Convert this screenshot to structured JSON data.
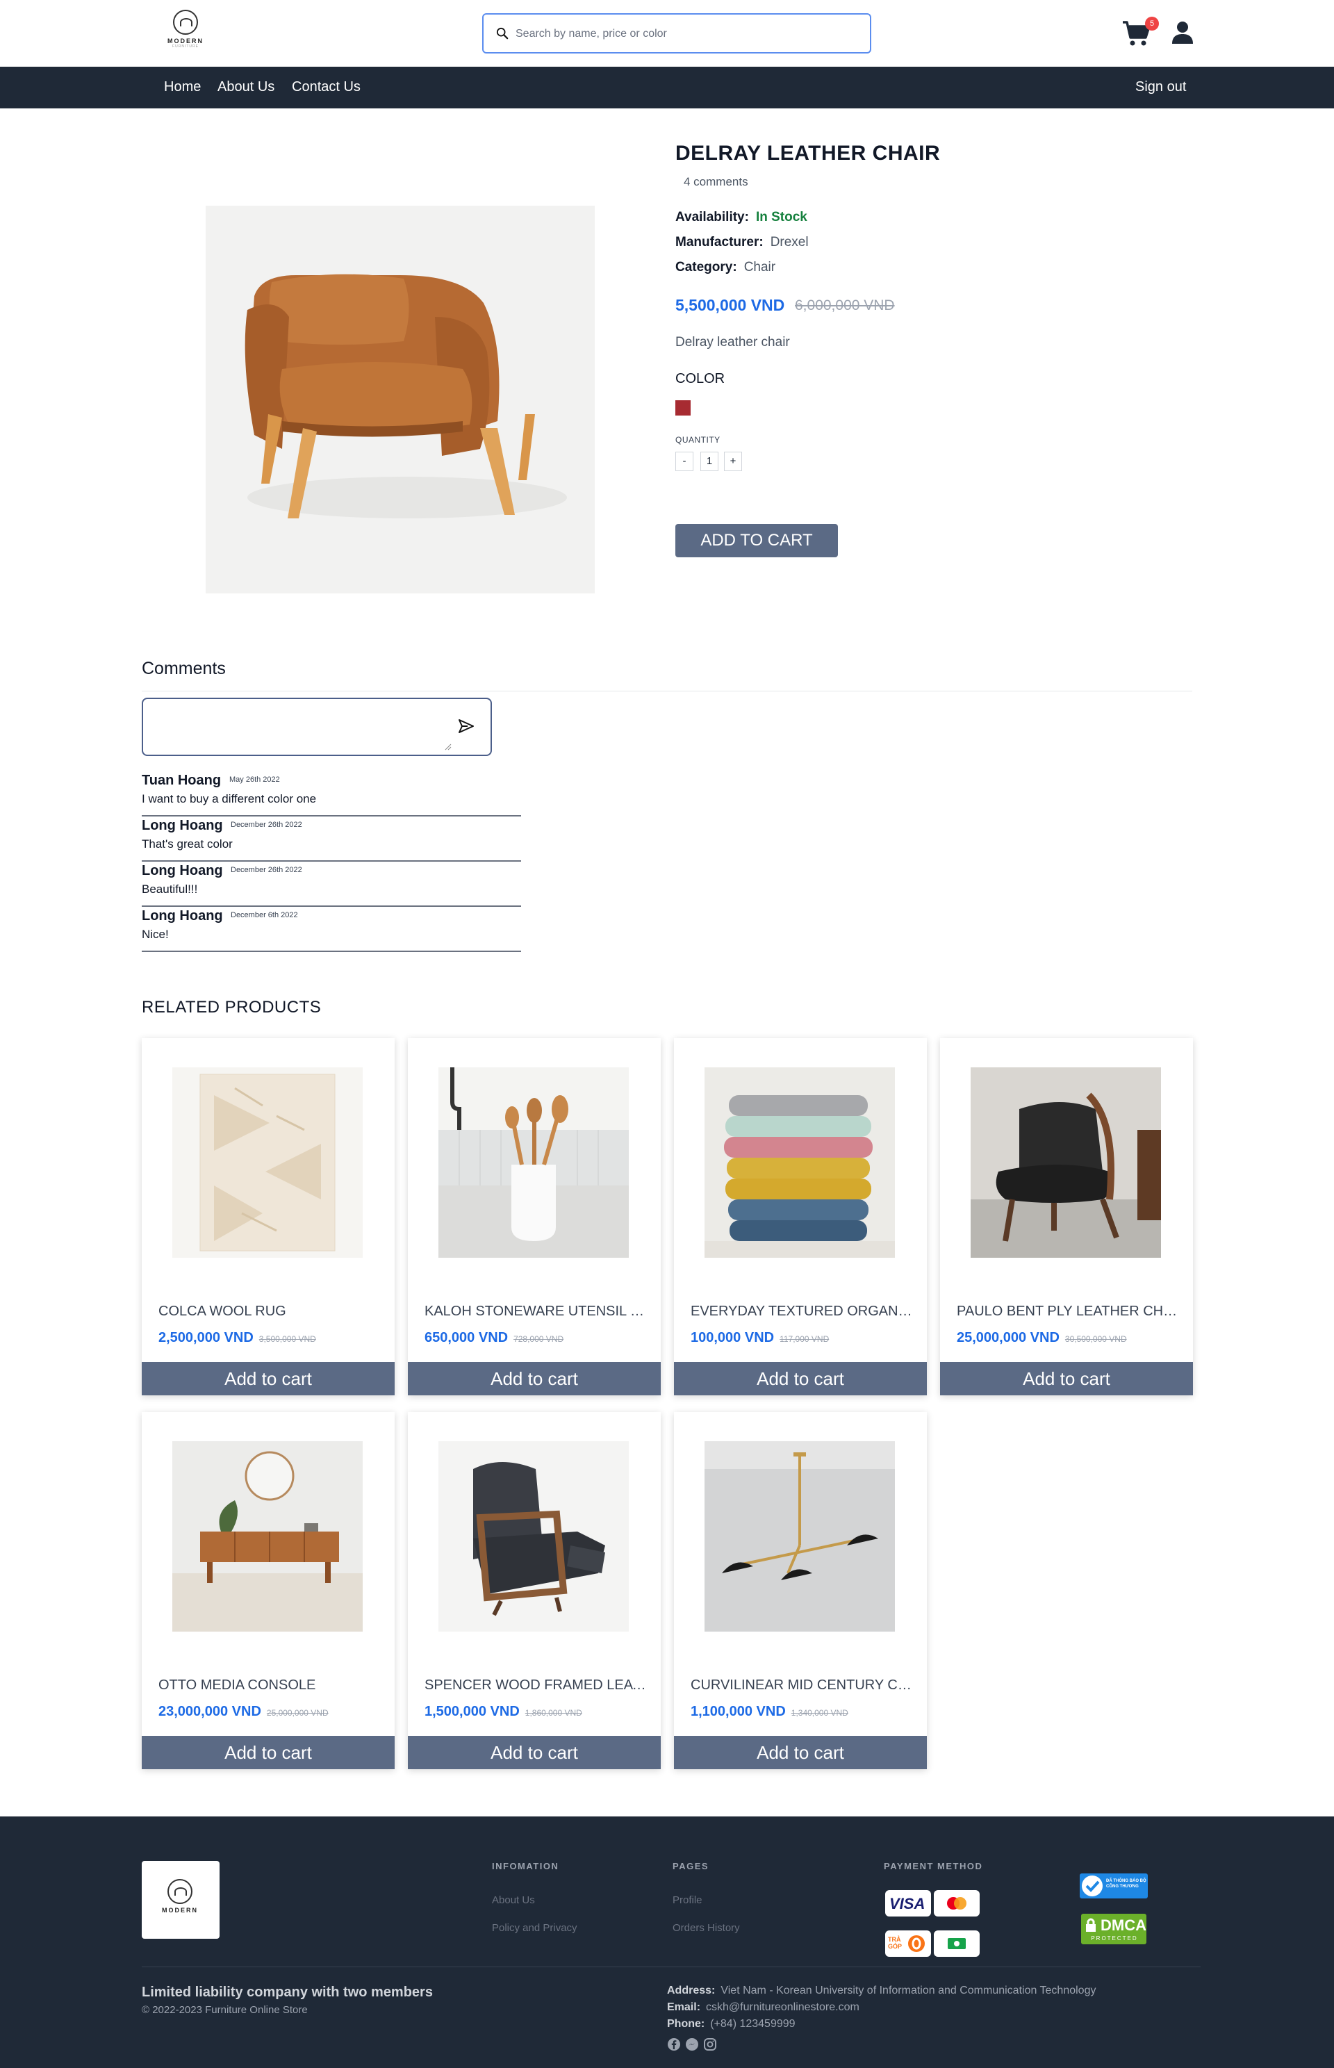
{
  "header": {
    "logo_text": "MODERN",
    "logo_sub": "FURNITURE",
    "search_placeholder": "Search by name, price or color",
    "cart_count": "5"
  },
  "nav": {
    "links": [
      "Home",
      "About Us",
      "Contact Us"
    ],
    "sign_out": "Sign out"
  },
  "product": {
    "title": "DELRAY LEATHER CHAIR",
    "comments_count": "4 comments",
    "availability_label": "Availability:",
    "availability_value": "In Stock",
    "manufacturer_label": "Manufacturer:",
    "manufacturer_value": "Drexel",
    "category_label": "Category:",
    "category_value": "Chair",
    "price": "5,500,000 VND",
    "old_price": "6,000,000 VND",
    "description": "Delray leather chair",
    "color_label": "COLOR",
    "color_swatch": "#a72b31",
    "quantity_label": "QUANTITY",
    "qty_minus": "-",
    "qty_value": "1",
    "qty_plus": "+",
    "add_to_cart": "ADD TO CART"
  },
  "comments": {
    "heading": "Comments",
    "items": [
      {
        "author": "Tuan Hoang",
        "date": "May 26th 2022",
        "text": "I want to buy a different color one"
      },
      {
        "author": "Long Hoang",
        "date": "December 26th 2022",
        "text": "That's great color"
      },
      {
        "author": "Long Hoang",
        "date": "December 26th 2022",
        "text": "Beautiful!!!"
      },
      {
        "author": "Long Hoang",
        "date": "December 6th 2022",
        "text": "Nice!"
      }
    ]
  },
  "related": {
    "heading": "RELATED PRODUCTS",
    "button_label": "Add to cart",
    "items": [
      {
        "name": "COLCA WOOL RUG",
        "price": "2,500,000 VND",
        "old_price": "3,500,000 VND"
      },
      {
        "name": "KALOH STONEWARE UTENSIL HOLDER",
        "price": "650,000 VND",
        "old_price": "728,000 VND"
      },
      {
        "name": "EVERYDAY TEXTURED ORGANIC COTTON TOWELS",
        "price": "100,000 VND",
        "old_price": "117,000 VND"
      },
      {
        "name": "PAULO BENT PLY LEATHER CHAIR",
        "price": "25,000,000 VND",
        "old_price": "30,500,000 VND"
      },
      {
        "name": "OTTO MEDIA CONSOLE",
        "price": "23,000,000 VND",
        "old_price": "25,000,000 VND"
      },
      {
        "name": "SPENCER WOOD FRAMED LEATHER RECLINER",
        "price": "1,500,000 VND",
        "old_price": "1,860,000 VND"
      },
      {
        "name": "CURVILINEAR MID CENTURY CHANDELIER",
        "price": "1,100,000 VND",
        "old_price": "1,340,000 VND"
      }
    ]
  },
  "footer": {
    "info_heading": "INFOMATION",
    "info_links": [
      "About Us",
      "Policy and Privacy"
    ],
    "pages_heading": "PAGES",
    "pages_links": [
      "Profile",
      "Orders History"
    ],
    "payment_heading": "PAYMENT METHOD",
    "payment_icons": [
      "visa",
      "mastercard",
      "tra-gop",
      "cash"
    ],
    "company": "Limited liability company with two members",
    "copyright": "© 2022-2023 Furniture Online Store",
    "address_label": "Address:",
    "address": "Viet Nam - Korean University of Information and Communication Technology",
    "email_label": "Email:",
    "email": "cskh@furnitureonlinestore.com",
    "phone_label": "Phone:",
    "phone": "(+84) 123459999",
    "badge_registered": "ĐÃ THÔNG BÁO BỘ CÔNG THƯƠNG",
    "badge_dmca": "DMCA",
    "badge_dmca_sub": "PROTECTED",
    "visa_text": "VISA",
    "tragop_text": "TRẢ GÓP"
  },
  "colors": {
    "nav_bg": "#1f2937",
    "price": "#1d6ae5",
    "button": "#5b6a85",
    "in_stock": "#15803d"
  }
}
